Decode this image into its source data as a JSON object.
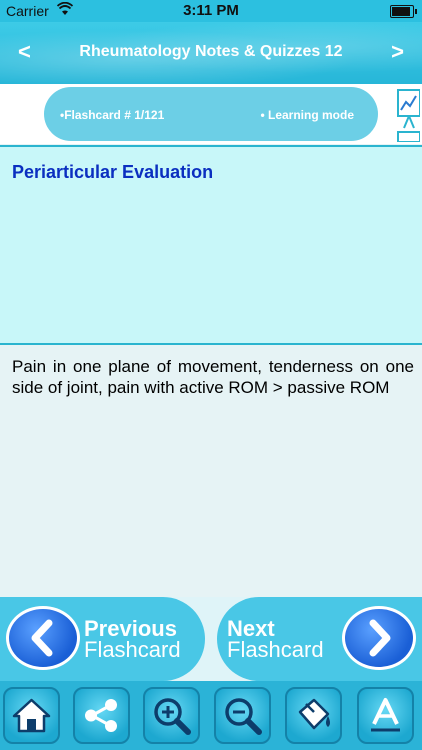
{
  "status_bar": {
    "carrier": "Carrier",
    "time": "3:11 PM"
  },
  "nav": {
    "title": "Rheumatology Notes & Quizzes 12",
    "prev": "<",
    "next": ">"
  },
  "info": {
    "counter": "•Flashcard #  1/121",
    "mode": "• Learning mode"
  },
  "question": {
    "title": "Periarticular Evaluation"
  },
  "answer": {
    "text": "Pain in one plane of movement, tenderness on one side of joint, pain with active ROM > passive ROM"
  },
  "card_nav": {
    "prev_line1": "Previous",
    "prev_line2": "Flashcard",
    "next_line1": "Next",
    "next_line2": "Flashcard"
  },
  "toolbar": {
    "icons": [
      "home-icon",
      "share-icon",
      "zoom-in-icon",
      "zoom-out-icon",
      "paint-bucket-icon",
      "font-icon"
    ]
  },
  "colors": {
    "accent": "#2cc0e0",
    "question_title": "#0b2fc0",
    "button_blue": "#1a5fd6"
  }
}
